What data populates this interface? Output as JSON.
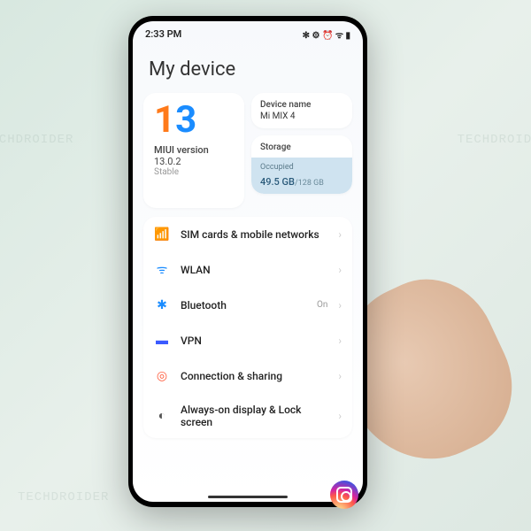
{
  "statusbar": {
    "time": "2:33 PM",
    "icons": "✻ ⚙ ⏰ ᯤ ▮"
  },
  "page_title": "My device",
  "miui": {
    "logo_1": "1",
    "logo_3": "3",
    "label": "MIUI version",
    "version": "13.0.2",
    "channel": "Stable"
  },
  "device_name_card": {
    "label": "Device name",
    "value": "Mi MIX 4"
  },
  "storage_card": {
    "label": "Storage",
    "occupied_label": "Occupied",
    "used": "49.5 GB",
    "total": "/128 GB"
  },
  "settings": [
    {
      "icon": "📶",
      "icon_name": "sim-icon",
      "icon_color": "#ffb020",
      "label": "SIM cards & mobile networks",
      "status": ""
    },
    {
      "icon": "ᯤ",
      "icon_name": "wifi-icon",
      "icon_color": "#1a8cff",
      "label": "WLAN",
      "status": ""
    },
    {
      "icon": "✱",
      "icon_name": "bluetooth-icon",
      "icon_color": "#1a8cff",
      "label": "Bluetooth",
      "status": "On"
    },
    {
      "icon": "▬",
      "icon_name": "vpn-icon",
      "icon_color": "#3a5aff",
      "label": "VPN",
      "status": ""
    },
    {
      "icon": "◎",
      "icon_name": "sharing-icon",
      "icon_color": "#ff5a3a",
      "label": "Connection & sharing",
      "status": ""
    },
    {
      "icon": "◐",
      "icon_name": "aod-icon",
      "icon_color": "#555",
      "label": "Always-on display & Lock screen",
      "status": ""
    }
  ],
  "watermark_text": "TECHDROIDER"
}
